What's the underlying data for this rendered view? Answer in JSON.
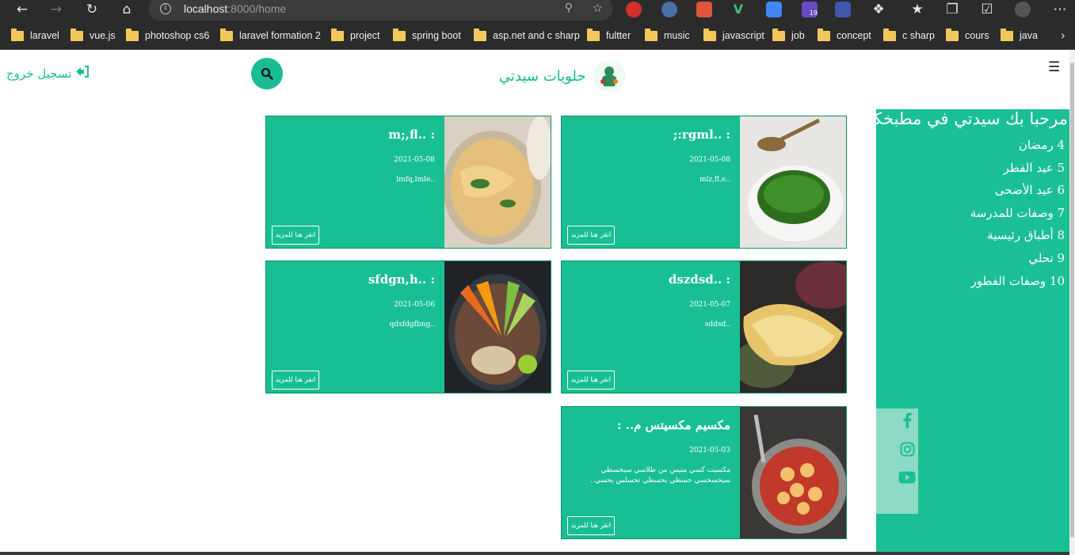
{
  "browser": {
    "url_host": "localhost",
    "url_path": ":8000/home",
    "ext_badge": "19",
    "bookmarks": [
      "laravel",
      "vue.js",
      "photoshop cs6",
      "laravel formation 2",
      "project",
      "spring boot",
      "asp.net and c sharp",
      "fultter",
      "music",
      "javascript",
      "job",
      "concept",
      "c sharp",
      "cours",
      "java"
    ]
  },
  "header": {
    "brand": "حلويات سيدتي",
    "logout": "تسجيل خروج"
  },
  "sidebar": {
    "title": "مرحبا بك سيدتي في مطبخكي",
    "items": [
      "4 رمضان",
      "5 عيد الفطر",
      "6 عيد الأضحى",
      "7 وصفات للمدرسة",
      "8 أطباق رئيسية",
      "9 تحلي",
      "10 وصفات الفطور"
    ]
  },
  "cards": [
    {
      "title": ": ..rgml:;",
      "date": "2021-05-08",
      "desc": "..mlz,fl,e",
      "button": "انقر هنا للمزيد"
    },
    {
      "title": ": ..m;,fl",
      "date": "2021-05-08",
      "desc": "..lmfq,lmle",
      "button": "انقر هنا للمزيد"
    },
    {
      "title": ": ..dszdsd",
      "date": "2021-05-07",
      "desc": "..sddsd",
      "button": "انقر هنا للمزيد"
    },
    {
      "title": ": ..sfdgn,h",
      "date": "2021-05-06",
      "desc": "..qdsfdgfbng",
      "button": "انقر هنا للمزيد"
    },
    {
      "title": "مكسيم مكسيتس م.. :",
      "date": "2021-05-03",
      "desc": "مكسيت كسي منيس من طلاسي سيخسطي سيخسخسي حسطي يحسطي تحسلس يحسي..",
      "button": "انقر هنا للمزيد"
    }
  ]
}
